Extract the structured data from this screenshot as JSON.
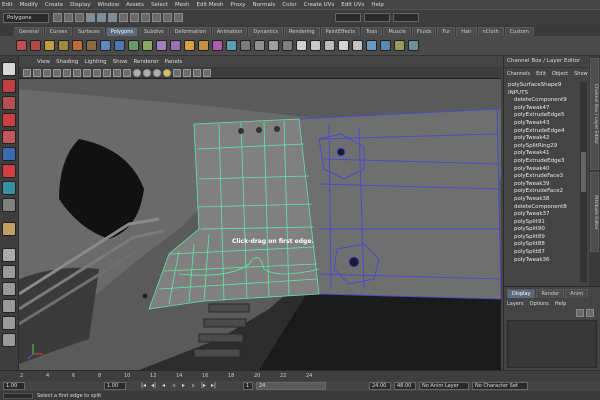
{
  "menus": [
    "Edit",
    "Modify",
    "Create",
    "Display",
    "Window",
    "Assets",
    "Select",
    "Mesh",
    "Edit Mesh",
    "Proxy",
    "Normals",
    "Color",
    "Create UVs",
    "Edit UVs",
    "Help"
  ],
  "status": {
    "mode": "Polygons"
  },
  "shelf_tabs": [
    "General",
    "Curves",
    "Surfaces",
    "Polygons",
    "Subdivs",
    "Deformation",
    "Animation",
    "Dynamics",
    "Rendering",
    "PaintEffects",
    "Toon",
    "Muscle",
    "Fluids",
    "Fur",
    "Hair",
    "nCloth",
    "Custom"
  ],
  "shelf_active": "Polygons",
  "panel_menu": [
    "View",
    "Shading",
    "Lighting",
    "Show",
    "Renderer",
    "Panels"
  ],
  "viewport": {
    "hint": "Click-drag on first edge."
  },
  "channel_box": {
    "title": "Channel Box / Layer Editor",
    "menu": [
      "Channels",
      "Edit",
      "Object",
      "Show"
    ],
    "lines": [
      "polySurfaceShape9",
      "INPUTS",
      "deleteComponent9",
      "polyTweak47",
      "polyExtrudeEdge5",
      "polyTweak43",
      "polyExtrudeEdge4",
      "polyTweak42",
      "polySplitRing29",
      "polyTweak41",
      "polyExtrudeEdge3",
      "polyTweak40",
      "polyExtrudeFace3",
      "polyTweak39",
      "polyExtrudeFace2",
      "polyTweak38",
      "deleteComponent8",
      "polyTweak37",
      "polySplit91",
      "polySplit90",
      "polySplit89",
      "polySplit88",
      "polySplit87",
      "polyTweak36"
    ]
  },
  "side_tabs": [
    "Channel Box / Layer Editor",
    "Attribute Editor"
  ],
  "layer_editor": {
    "tabs": [
      "Display",
      "Render",
      "Anim"
    ],
    "active": "Display",
    "menu": [
      "Layers",
      "Options",
      "Help"
    ]
  },
  "time_ticks": [
    "2",
    "4",
    "6",
    "8",
    "10",
    "12",
    "14",
    "16",
    "18",
    "20",
    "22",
    "24"
  ],
  "range": {
    "start": "1.00",
    "current": "1.00",
    "range_start": "1",
    "range_end": "24",
    "end": "24.00",
    "end2": "48.00",
    "anim_layer": "No Anim Layer",
    "char_set": "No Character Set"
  },
  "help": "Select a first edge to split",
  "colors": {
    "wire": "#5fe6a8",
    "wire_blue": "#4a4acc",
    "accent": "#5b6b7d"
  }
}
